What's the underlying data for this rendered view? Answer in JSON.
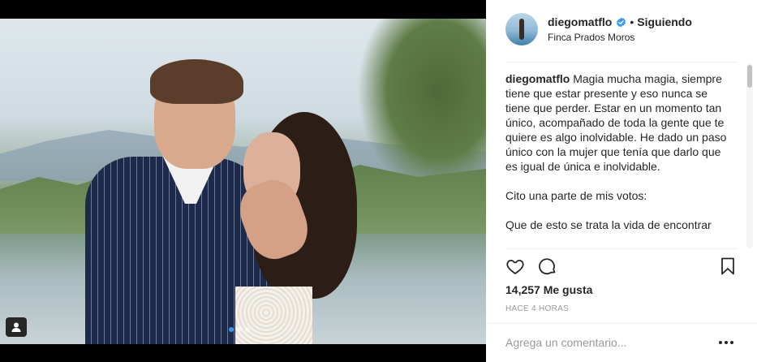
{
  "post": {
    "username": "diegomatflo",
    "following_label": "Siguiendo",
    "separator": "•",
    "location": "Finca Prados Moros",
    "verified_icon": "verified-badge-icon",
    "caption": {
      "paragraph1": "Magia mucha magia, siempre tiene que estar presente y eso nunca se tiene que perder. Estar en un momento tan único, acompañado de toda la gente que te quiere es algo inolvidable. He dado un paso único con la mujer que tenía que darlo que es igual de única e inolvidable.",
      "paragraph2": "Cito una parte de mis votos:",
      "paragraph3": "Que de esto se trata la vida de encontrar"
    },
    "likes": "14,257 Me gusta",
    "timestamp": "HACE 4 HORAS",
    "comment_placeholder": "Agrega un comentario..."
  },
  "media": {
    "carousel_count": 3,
    "carousel_active": 0,
    "tag_icon": "person-tag-icon"
  },
  "icons": {
    "like": "heart-icon",
    "comment": "comment-bubble-icon",
    "save": "bookmark-icon",
    "more": "more-options-icon"
  },
  "colors": {
    "verified": "#3897f0",
    "text": "#262626",
    "muted": "#999999",
    "active_dot": "#3897f0"
  }
}
